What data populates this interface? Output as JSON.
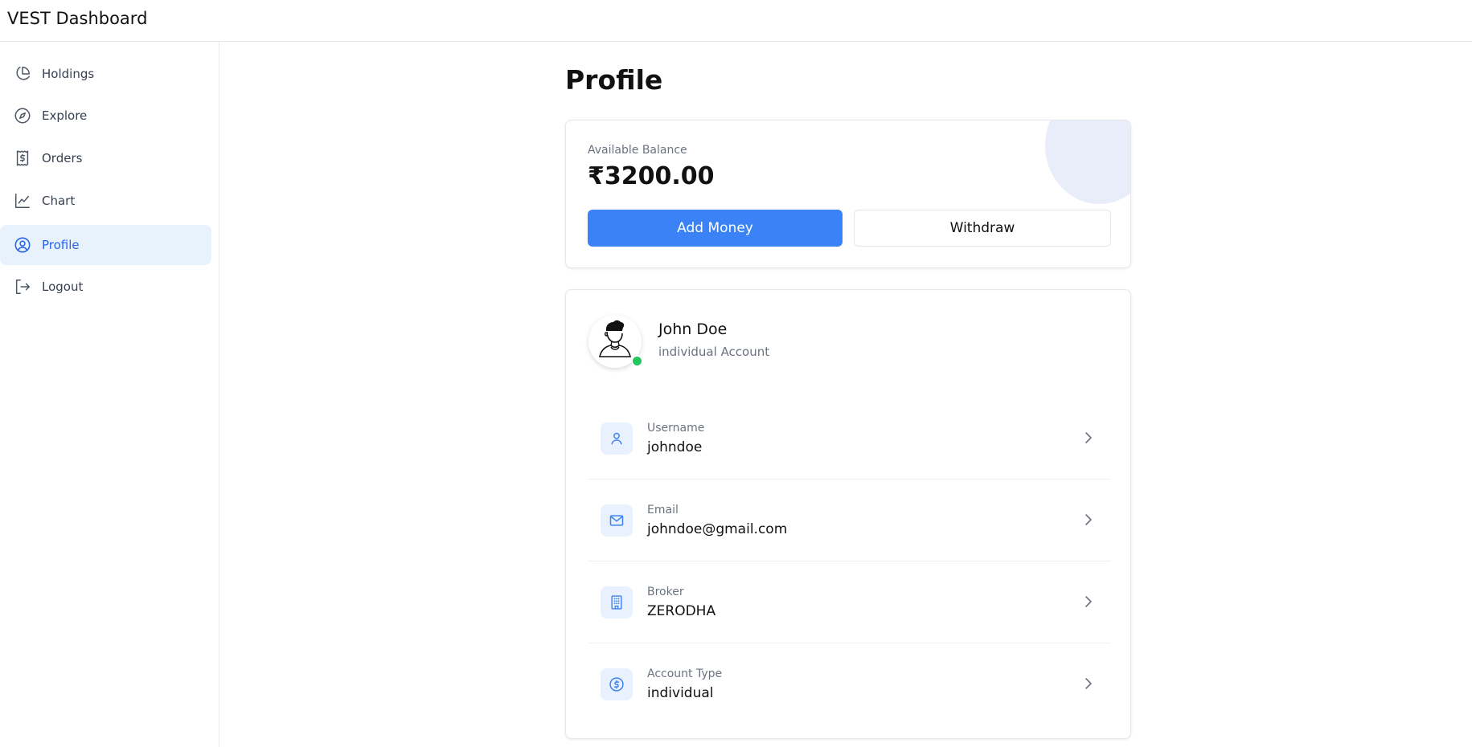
{
  "app": {
    "title": "VEST Dashboard"
  },
  "sidebar": {
    "items": [
      {
        "label": "Holdings",
        "icon": "pie-chart-icon",
        "active": false
      },
      {
        "label": "Explore",
        "icon": "compass-icon",
        "active": false
      },
      {
        "label": "Orders",
        "icon": "receipt-dollar-icon",
        "active": false
      },
      {
        "label": "Chart",
        "icon": "line-chart-icon",
        "active": false
      },
      {
        "label": "Profile",
        "icon": "user-circle-icon",
        "active": true
      },
      {
        "label": "Logout",
        "icon": "logout-icon",
        "active": false
      }
    ]
  },
  "main": {
    "title": "Profile",
    "balance": {
      "label": "Available Balance",
      "value": "₹3200.00",
      "add_money_label": "Add Money",
      "withdraw_label": "Withdraw"
    },
    "profile": {
      "name": "John Doe",
      "subtitle": "individual Account",
      "online": true,
      "fields": [
        {
          "label": "Username",
          "value": "johndoe",
          "icon": "user-icon"
        },
        {
          "label": "Email",
          "value": "johndoe@gmail.com",
          "icon": "mail-icon"
        },
        {
          "label": "Broker",
          "value": "ZERODHA",
          "icon": "building-icon"
        },
        {
          "label": "Account Type",
          "value": "individual",
          "icon": "dollar-circle-icon"
        }
      ]
    }
  },
  "colors": {
    "accent": "#3b82f6",
    "active_nav_bg": "#e8f2fd",
    "active_nav_text": "#2563eb",
    "online": "#22c55e",
    "icon_blue": "#3b82f6"
  }
}
